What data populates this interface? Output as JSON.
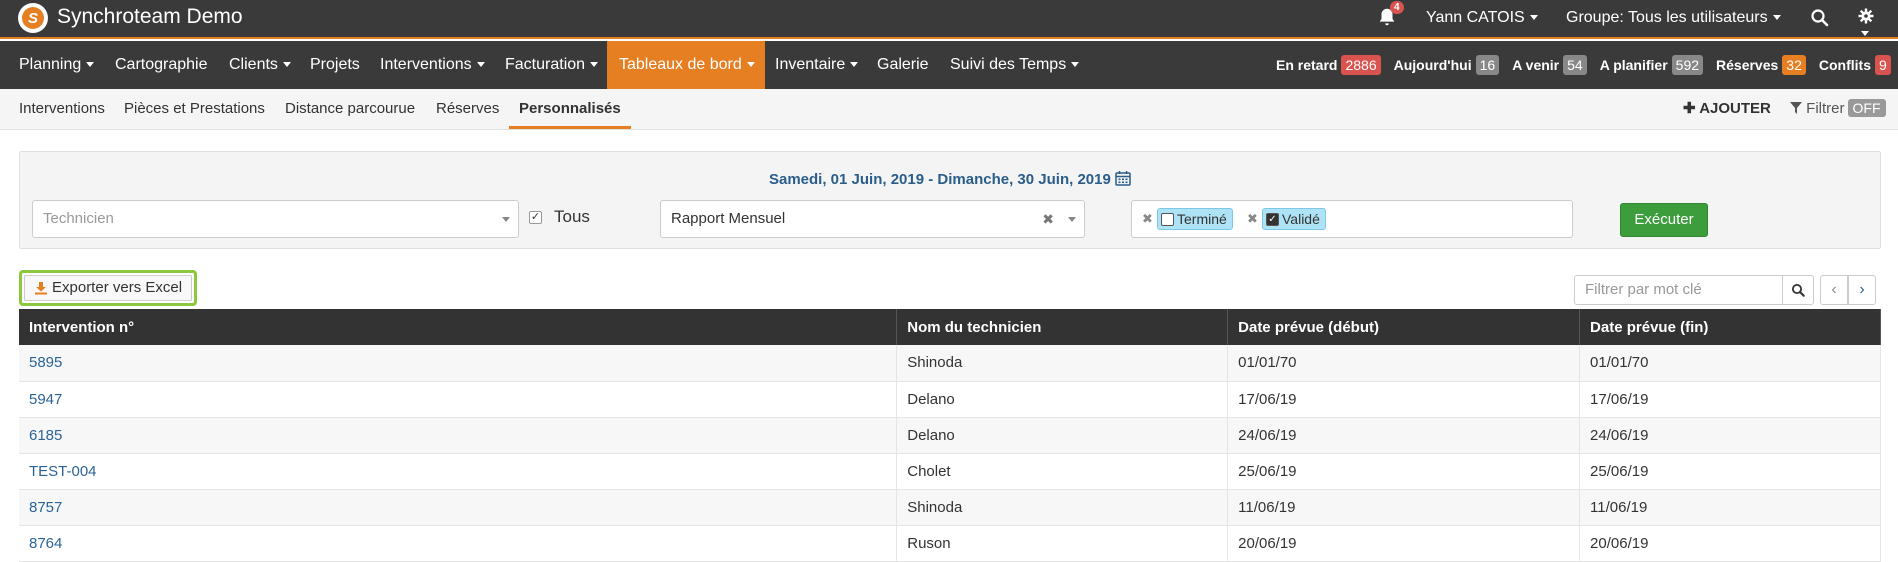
{
  "topbar": {
    "app_title": "Synchroteam Demo",
    "notification_count": "4",
    "user": "Yann CATOIS",
    "group": "Groupe: Tous les utilisateurs",
    "accent_color": "#e67e22"
  },
  "mainnav": {
    "items": [
      "Planning",
      "Cartographie",
      "Clients",
      "Projets",
      "Interventions",
      "Facturation",
      "Tableaux de bord",
      "Inventaire",
      "Galerie",
      "Suivi des Temps"
    ],
    "active": "Tableaux de bord",
    "counters": [
      {
        "label": "En retard",
        "value": "2886",
        "color": "#d9534f"
      },
      {
        "label": "Aujourd'hui",
        "value": "16",
        "color": "#888888"
      },
      {
        "label": "A venir",
        "value": "54",
        "color": "#888888"
      },
      {
        "label": "A planifier",
        "value": "592",
        "color": "#888888"
      },
      {
        "label": "Réserves",
        "value": "32",
        "color": "#e67e22"
      },
      {
        "label": "Conflits",
        "value": "9",
        "color": "#d9534f"
      }
    ]
  },
  "subnav": {
    "items": [
      "Interventions",
      "Pièces et Prestations",
      "Distance parcourue",
      "Réserves",
      "Personnalisés"
    ],
    "active": "Personnalisés",
    "add_label": "AJOUTER",
    "filter_label": "Filtrer",
    "filter_state": "OFF"
  },
  "filters": {
    "date_range": "Samedi, 01 Juin, 2019 - Dimanche, 30 Juin, 2019",
    "technician_placeholder": "Technicien",
    "all_label": "Tous",
    "report": "Rapport Mensuel",
    "status_tags": [
      {
        "label": "Terminé",
        "checked": false
      },
      {
        "label": "Validé",
        "checked": true
      }
    ],
    "execute_label": "Exécuter"
  },
  "toolbar": {
    "export_label": "Exporter vers Excel",
    "search_placeholder": "Filtrer par mot clé"
  },
  "table": {
    "columns": [
      "Intervention n°",
      "Nom du technicien",
      "Date prévue (début)",
      "Date prévue (fin)"
    ],
    "rows": [
      [
        "5895",
        "Shinoda",
        "01/01/70",
        "01/01/70"
      ],
      [
        "5947",
        "Delano",
        "17/06/19",
        "17/06/19"
      ],
      [
        "6185",
        "Delano",
        "24/06/19",
        "24/06/19"
      ],
      [
        "TEST-004",
        "Cholet",
        "25/06/19",
        "25/06/19"
      ],
      [
        "8757",
        "Shinoda",
        "11/06/19",
        "11/06/19"
      ],
      [
        "8764",
        "Ruson",
        "20/06/19",
        "20/06/19"
      ]
    ]
  }
}
